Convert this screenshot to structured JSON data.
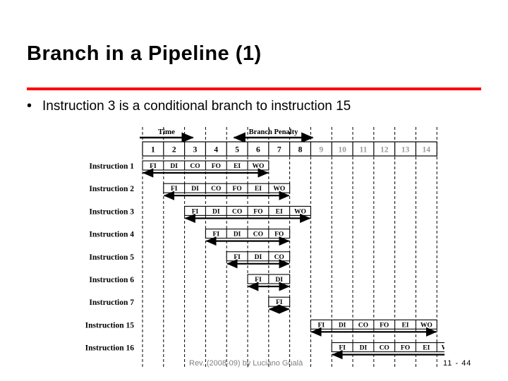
{
  "slide": {
    "title": "Branch in a Pipeline (1)",
    "accent_color": "#FF0000",
    "bullet_marker": "•",
    "bullet_text": "Instruction 3 is a conditional branch to instruction 15"
  },
  "footer": {
    "note": "Rev. (2008-09) by Luciano Gualà",
    "page": "11 -  44"
  },
  "diagram": {
    "time_label": "Time",
    "branch_penalty_label": "Branch Penalty",
    "cycles": [
      "1",
      "2",
      "3",
      "4",
      "5",
      "6",
      "7",
      "8",
      "9",
      "10",
      "11",
      "12",
      "13",
      "14"
    ],
    "cycle_active_count": 8,
    "rows": [
      {
        "label": "Instruction 1",
        "start": 0,
        "stages": [
          "FI",
          "DI",
          "CO",
          "FO",
          "EI",
          "WO"
        ]
      },
      {
        "label": "Instruction 2",
        "start": 1,
        "stages": [
          "FI",
          "DI",
          "CO",
          "FO",
          "EI",
          "WO"
        ]
      },
      {
        "label": "Instruction 3",
        "start": 2,
        "stages": [
          "FI",
          "DI",
          "CO",
          "FO",
          "EI",
          "WO"
        ]
      },
      {
        "label": "Instruction 4",
        "start": 3,
        "stages": [
          "FI",
          "DI",
          "CO",
          "FO"
        ]
      },
      {
        "label": "Instruction 5",
        "start": 4,
        "stages": [
          "FI",
          "DI",
          "CO"
        ]
      },
      {
        "label": "Instruction 6",
        "start": 5,
        "stages": [
          "FI",
          "DI"
        ]
      },
      {
        "label": "Instruction 7",
        "start": 6,
        "stages": [
          "FI"
        ]
      },
      {
        "label": "Instruction 15",
        "start": 8,
        "stages": [
          "FI",
          "DI",
          "CO",
          "FO",
          "EI",
          "WO"
        ]
      },
      {
        "label": "Instruction 16",
        "start": 9,
        "stages": [
          "FI",
          "DI",
          "CO",
          "FO",
          "EI",
          "WO"
        ]
      }
    ]
  }
}
